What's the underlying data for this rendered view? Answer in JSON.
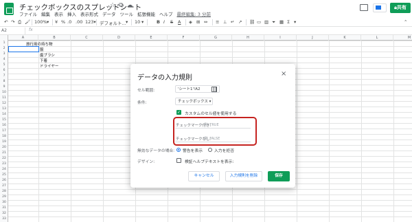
{
  "app": {
    "doc_title": "チェックボックスのスプレッドシート",
    "last_edit": "最終編集: 3 分前",
    "share_label": "共有"
  },
  "menu": [
    "ファイル",
    "編集",
    "表示",
    "挿入",
    "表示形式",
    "データ",
    "ツール",
    "拡張機能",
    "ヘルプ"
  ],
  "toolbar": {
    "zoom": "100%",
    "currency": "¥",
    "percent": "%",
    "decimal_dec": ".0",
    "decimal_inc": ".00",
    "more_formats": "123▾",
    "font": "デフォルト...",
    "font_size": "10",
    "bold": "B",
    "italic": "I",
    "strike": "S",
    "text_color": "A"
  },
  "formula_bar": {
    "name_box": "A2",
    "fx": "fx"
  },
  "columns": [
    "A",
    "B",
    "C",
    "D",
    "E",
    "F",
    "G",
    "H",
    "I",
    "J",
    "K",
    "L",
    "M"
  ],
  "rows": [
    "1",
    "2",
    "3",
    "4",
    "5",
    "6",
    "7",
    "8",
    "9",
    "10",
    "11",
    "12",
    "13",
    "14",
    "15",
    "16",
    "17",
    "18",
    "19",
    "20",
    "21",
    "22",
    "23",
    "24",
    "25",
    "26",
    "27",
    "28",
    "29",
    "30",
    "31",
    "32",
    "33"
  ],
  "cells": {
    "b1": "旅行用の持ち物",
    "b2": "服",
    "b3": "歯ブラシ",
    "b4": "下着",
    "b5": "ドライヤー"
  },
  "dialog": {
    "title": "データの入力規則",
    "close": "×",
    "range_label": "セル範囲:",
    "range_value": "'シート1'!A2",
    "criteria_label": "条件:",
    "criteria_value": "チェックボックス",
    "custom_values_label": "カスタムのセル値を使用する",
    "checked_label": "チェックマーク付き:",
    "checked_placeholder": "例: TRUE",
    "unchecked_label": "チェックマークなし:",
    "unchecked_placeholder": "例: FALSE",
    "invalid_label": "無効なデータの場合:",
    "invalid_option_warn": "警告を表示",
    "invalid_option_reject": "入力を拒否",
    "appearance_label": "デザイン:",
    "help_text_label": "検証ヘルプテキストを表示:",
    "cancel_label": "キャンセル",
    "remove_label": "入力規則を削除",
    "save_label": "保存"
  },
  "colors": {
    "accent_green": "#0f9d58",
    "accent_blue": "#1a73e8",
    "highlight_red": "#c5221f"
  }
}
